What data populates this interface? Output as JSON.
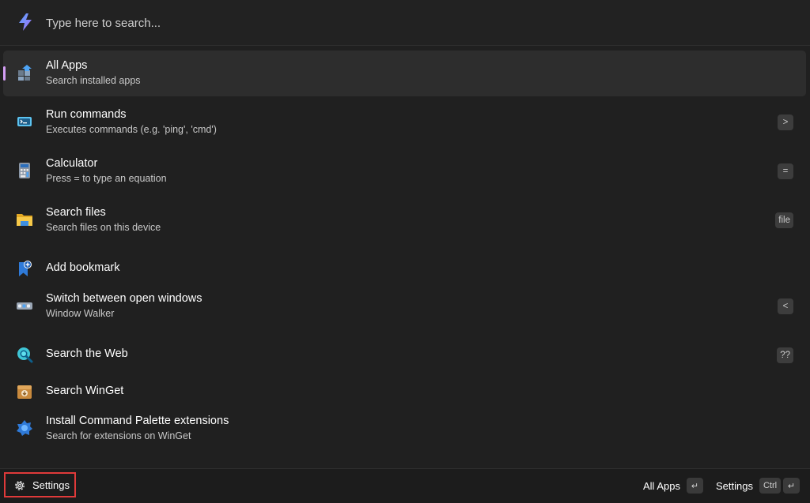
{
  "search": {
    "placeholder": "Type here to search..."
  },
  "items": [
    {
      "title": "All Apps",
      "subtitle": "Search installed apps",
      "shortcut": "",
      "icon": "all-apps-icon"
    },
    {
      "title": "Run commands",
      "subtitle": "Executes commands (e.g. 'ping', 'cmd')",
      "shortcut": ">",
      "icon": "terminal-icon"
    },
    {
      "title": "Calculator",
      "subtitle": "Press = to type an equation",
      "shortcut": "=",
      "icon": "calculator-icon"
    },
    {
      "title": "Search files",
      "subtitle": "Search files on this device",
      "shortcut": "file",
      "icon": "folder-icon"
    },
    {
      "title": "Add bookmark",
      "subtitle": "",
      "shortcut": "",
      "icon": "bookmark-add-icon"
    },
    {
      "title": "Switch between open windows",
      "subtitle": "Window Walker",
      "shortcut": "<",
      "icon": "window-walker-icon"
    },
    {
      "title": "Search the Web",
      "subtitle": "",
      "shortcut": "??",
      "icon": "web-search-icon"
    },
    {
      "title": "Search WinGet",
      "subtitle": "",
      "shortcut": "",
      "icon": "winget-icon"
    },
    {
      "title": "Install Command Palette extensions",
      "subtitle": "Search for extensions on WinGet",
      "shortcut": "",
      "icon": "extensions-icon"
    }
  ],
  "footer": {
    "settings_label": "Settings",
    "primary_action": "All Apps",
    "primary_key": "↵",
    "secondary_action": "Settings",
    "secondary_key_mod": "Ctrl",
    "secondary_key": "↵"
  },
  "colors": {
    "background": "#202020",
    "selected": "#2d2d2d",
    "accent": "#d39ef5",
    "highlight_border": "#e03a3a"
  }
}
